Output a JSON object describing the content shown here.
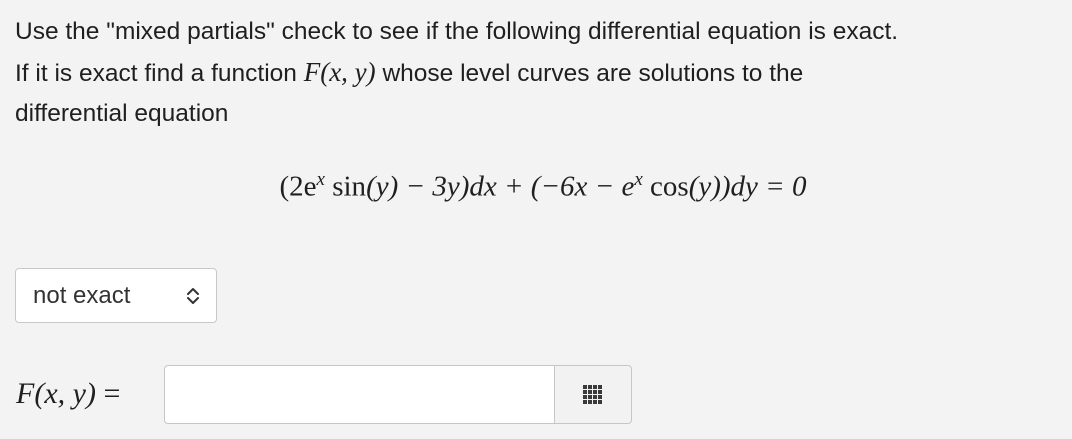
{
  "problem": {
    "line1": "Use the \"mixed partials\" check to see if the following differential equation is exact.",
    "line2_prefix": "If it is exact find a function ",
    "line2_suffix": " whose level curves are solutions to the",
    "line3": "differential equation",
    "function_symbol": "F",
    "function_args": "(x, y)"
  },
  "equation": {
    "part1": "(2e",
    "exp1": "x",
    "part2": " sin",
    "part3": "(y) − 3y)dx + (−6x − e",
    "exp2": "x",
    "part4": " cos",
    "part5": "(y))dy = 0"
  },
  "exactness_select": {
    "selected_value": "not exact",
    "icon": "up-down-arrows-icon"
  },
  "answer": {
    "label_f": "F",
    "label_args": "(x, y)",
    "label_eq": "=",
    "input_value": "",
    "palette_icon": "keypad-grid-icon"
  }
}
